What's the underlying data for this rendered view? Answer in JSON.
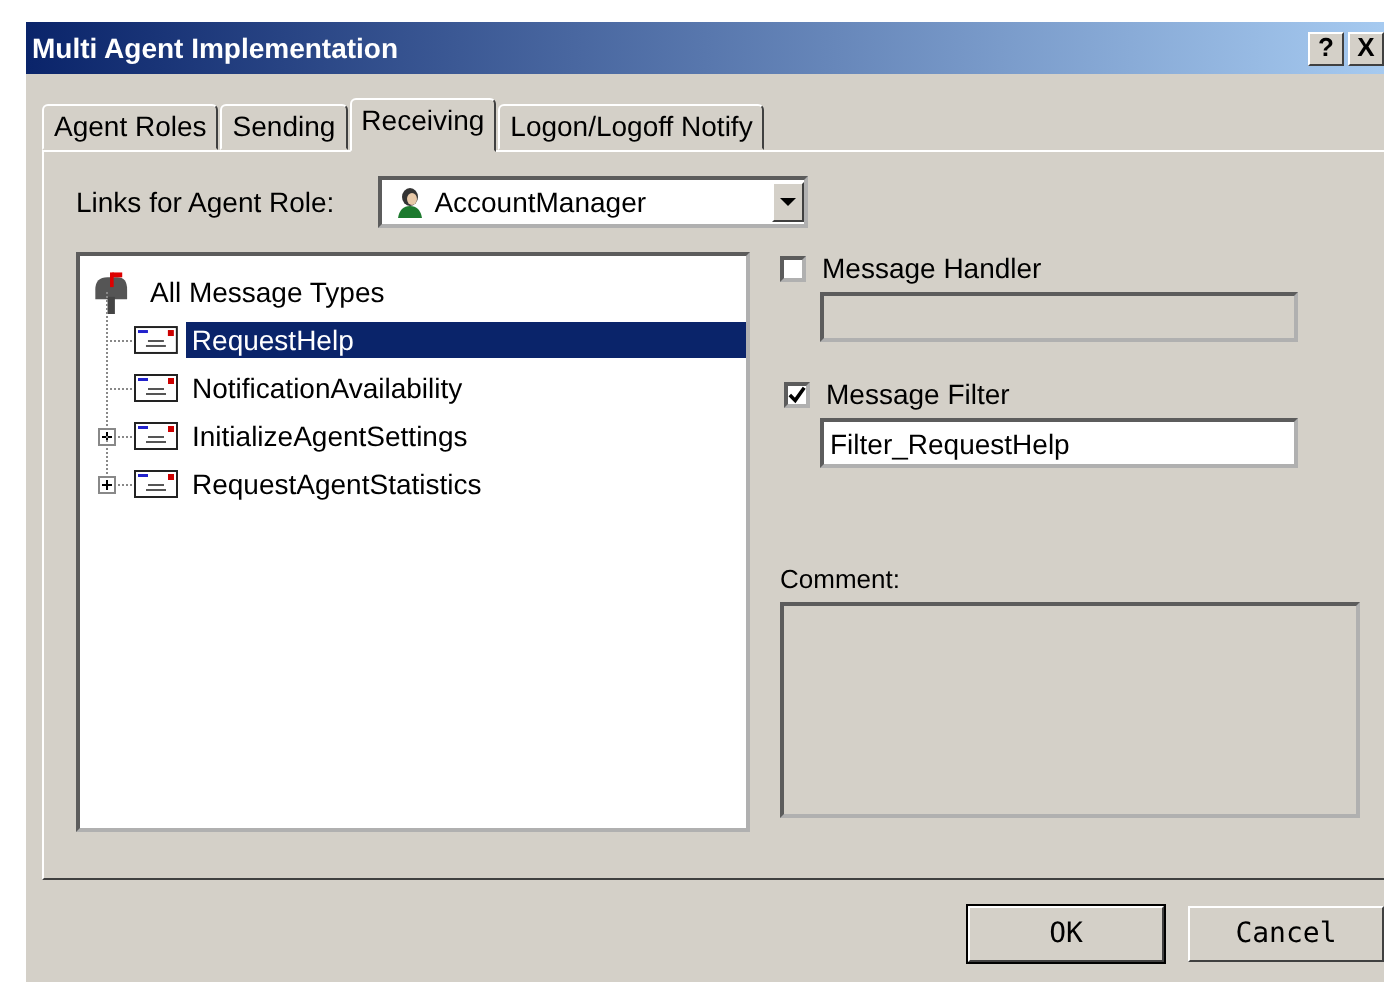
{
  "window": {
    "title": "Multi Agent Implementation",
    "help": "?",
    "close": "X"
  },
  "tabs": [
    {
      "label": "Agent Roles",
      "selected": false
    },
    {
      "label": "Sending",
      "selected": false
    },
    {
      "label": "Receiving",
      "selected": true
    },
    {
      "label": "Logon/Logoff Notify",
      "selected": false
    }
  ],
  "role": {
    "label": "Links for Agent Role:",
    "value": "AccountManager"
  },
  "tree": {
    "label": "All Message Types",
    "expanded": true,
    "children": [
      {
        "label": "RequestHelp",
        "selected": true,
        "expandable": false
      },
      {
        "label": "NotificationAvailability",
        "selected": false,
        "expandable": false
      },
      {
        "label": "InitializeAgentSettings",
        "selected": false,
        "expandable": true
      },
      {
        "label": "RequestAgentStatistics",
        "selected": false,
        "expandable": true
      }
    ]
  },
  "handler": {
    "label": "Message Handler",
    "checked": false
  },
  "filter": {
    "label": "Message Filter",
    "checked": true,
    "value": "Filter_RequestHelp"
  },
  "comment": {
    "label": "Comment:"
  },
  "buttons": [
    {
      "label": "OK",
      "default": true
    },
    {
      "label": "Cancel",
      "default": false
    }
  ]
}
